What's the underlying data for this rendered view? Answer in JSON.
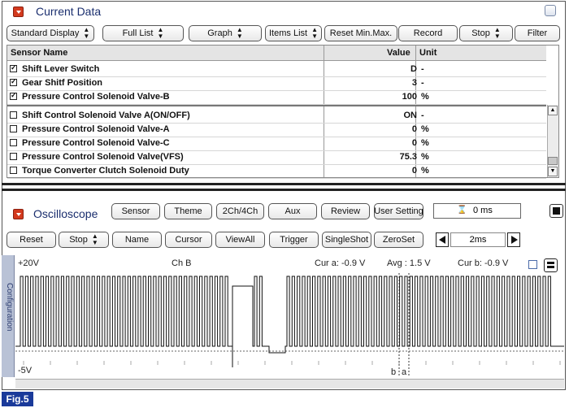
{
  "current_data": {
    "title": "Current Data",
    "toolbar": [
      {
        "label": "Standard Display",
        "arrows": true
      },
      {
        "label": "Full List",
        "arrows": true
      },
      {
        "label": "Graph",
        "arrows": true
      },
      {
        "label": "Items List",
        "arrows": true
      },
      {
        "label": "Reset Min.Max.",
        "arrows": false
      },
      {
        "label": "Record",
        "arrows": false
      },
      {
        "label": "Stop",
        "arrows": true
      },
      {
        "label": "Filter",
        "arrows": false
      }
    ],
    "columns": {
      "name": "Sensor Name",
      "value": "Value",
      "unit": "Unit"
    },
    "rows": [
      {
        "checked": true,
        "name": "Shift Lever Switch",
        "value": "D",
        "unit": "-"
      },
      {
        "checked": true,
        "name": "Gear Shitf Position",
        "value": "3",
        "unit": "-"
      },
      {
        "checked": true,
        "name": "Pressure Control Solenoid Valve-B",
        "value": "100",
        "unit": "%"
      },
      {
        "checked": false,
        "name": "Shift Control Solenoid Valve A(ON/OFF)",
        "value": "ON",
        "unit": "-"
      },
      {
        "checked": false,
        "name": "Pressure Control Solenoid Valve-A",
        "value": "0",
        "unit": "%"
      },
      {
        "checked": false,
        "name": "Pressure Control Solenoid Valve-C",
        "value": "0",
        "unit": "%"
      },
      {
        "checked": false,
        "name": "Pressure Control Solenoid Valve(VFS)",
        "value": "75.3",
        "unit": "%"
      },
      {
        "checked": false,
        "name": "Torque Converter Clutch Solenoid Duty",
        "value": "0",
        "unit": "%"
      }
    ]
  },
  "oscilloscope": {
    "title": "Oscilloscope",
    "top_buttons": [
      "Sensor",
      "Theme",
      "2Ch/4Ch",
      "Aux",
      "Review",
      "User Setting"
    ],
    "time_readout": "0 ms",
    "second_row_buttons": [
      {
        "label": "Reset",
        "arrows": false
      },
      {
        "label": "Stop",
        "arrows": true
      },
      {
        "label": "Name",
        "arrows": false
      },
      {
        "label": "Cursor",
        "arrows": false
      },
      {
        "label": "ViewAll",
        "arrows": false
      },
      {
        "label": "Trigger",
        "arrows": false
      },
      {
        "label": "SingleShot",
        "arrows": false
      },
      {
        "label": "ZeroSet",
        "arrows": false
      }
    ],
    "timebase": "2ms",
    "side_tab": "Configuration",
    "plot": {
      "y_max_label": "+20V",
      "y_min_label": "-5V",
      "channel": "Ch B",
      "cur_a": "Cur a: -0.9 V",
      "avg": "Avg : 1.5 V",
      "cur_b": "Cur b: -0.9 V",
      "cursor_b": "b",
      "cursor_a": "a"
    }
  },
  "figure_label": "Fig.5",
  "colors": {
    "accent_red": "#d33a1e",
    "title_blue": "#1a2e6e",
    "fig_bg": "#1a3a9a"
  }
}
